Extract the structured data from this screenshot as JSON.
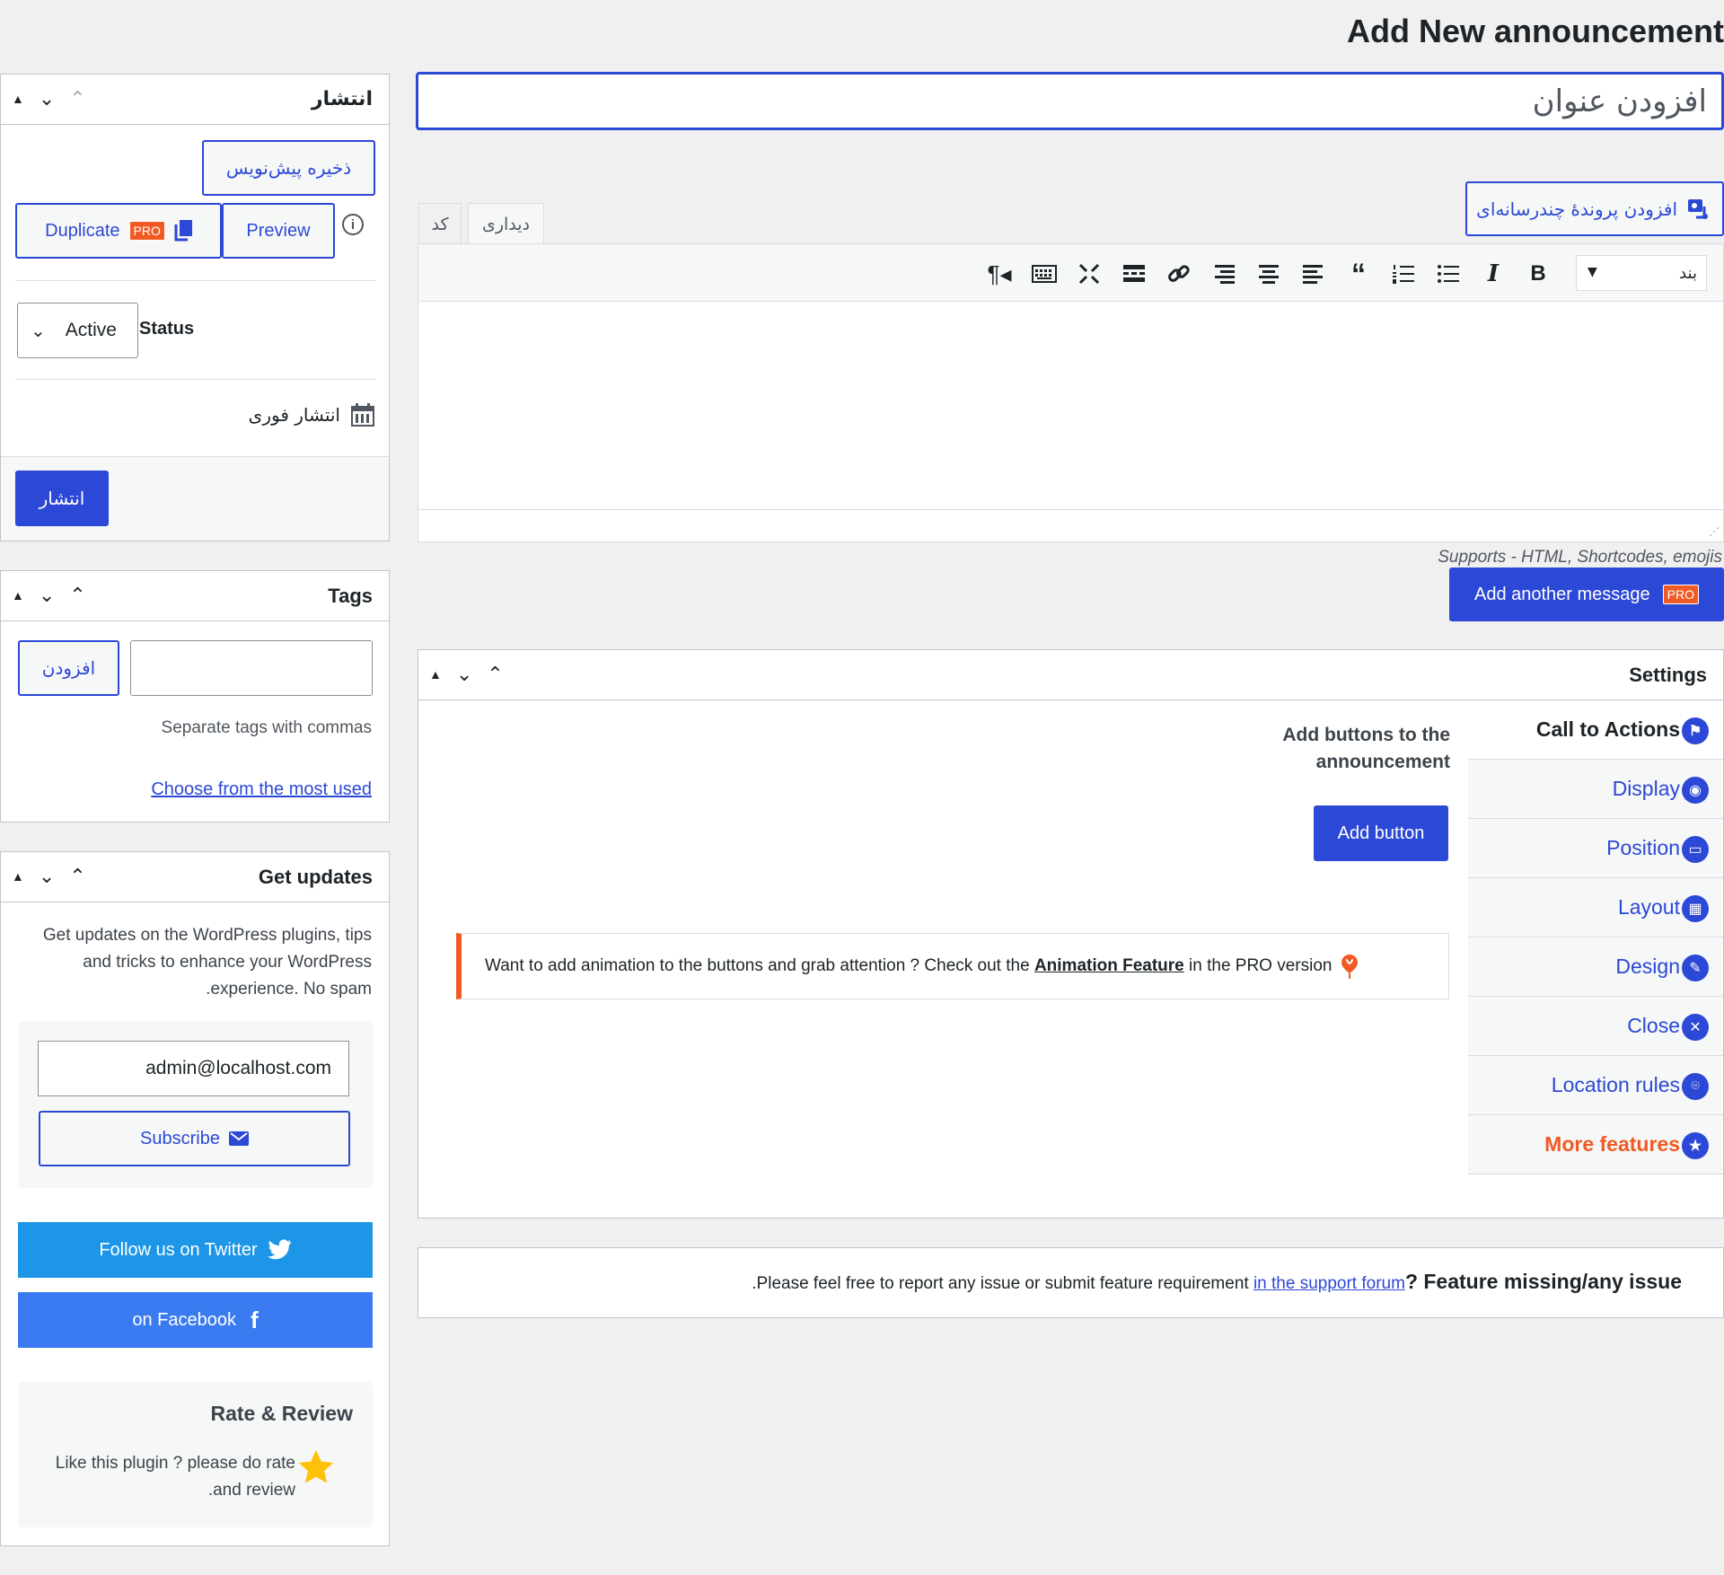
{
  "page": {
    "title": "Add New announcement"
  },
  "editor": {
    "title_placeholder": "افزودن عنوان",
    "add_media_label": "افزودن پروندهٔ چندرسانه‌ای",
    "tab_code": "کد",
    "tab_visual": "دیداری",
    "paragraph_select": "بند",
    "supports_note": "Supports - HTML, Shortcodes, emojis",
    "add_message_label": "Add another message",
    "pro_badge": "PRO",
    "toolbar_icons": [
      "paragraph-rtl-icon",
      "keyboard-icon",
      "fullscreen-icon",
      "read-more-icon",
      "link-icon",
      "align-right-icon",
      "align-center-icon",
      "align-left-icon",
      "blockquote-icon",
      "numbered-list-icon",
      "bullet-list-icon",
      "italic-icon",
      "bold-icon"
    ]
  },
  "publish": {
    "title": "انتشار",
    "save_draft": "ذخیره پیش‌نویس",
    "duplicate": "Duplicate",
    "pro_badge": "PRO",
    "preview": "Preview",
    "status_label": "Status",
    "status_value": "Active",
    "schedule_text": "انتشار فوری",
    "publish_button": "انتشار"
  },
  "tags": {
    "title": "Tags",
    "add_button": "افزودن",
    "hint": "Separate tags with commas",
    "choose_link": "Choose from the most used"
  },
  "updates": {
    "title": "Get updates",
    "description_lines": [
      "Get updates on the WordPress plugins, tips",
      "and tricks to enhance your WordPress",
      ".experience. No spam"
    ],
    "email_value": "admin@localhost.com",
    "subscribe": "Subscribe",
    "twitter": "Follow us on Twitter",
    "facebook": "on Facebook",
    "rate_title": "Rate & Review",
    "rate_lines": [
      "Like this plugin ? please do rate",
      ".and review"
    ]
  },
  "settings": {
    "title": "Settings",
    "section_heading_lines": [
      "Add buttons to the",
      "announcement"
    ],
    "add_button": "Add button",
    "notice_before": "Want to add animation to the buttons and grab attention ? Check out the ",
    "notice_link": "Animation Feature",
    "notice_after": " in the PRO version",
    "nav": [
      {
        "label": "Call to Actions",
        "icon": "flag-icon"
      },
      {
        "label": "Display",
        "icon": "eye-icon"
      },
      {
        "label": "Position",
        "icon": "window-icon"
      },
      {
        "label": "Layout",
        "icon": "layout-icon"
      },
      {
        "label": "Design",
        "icon": "brush-icon"
      },
      {
        "label": "Close",
        "icon": "close-icon"
      },
      {
        "label": "Location rules",
        "icon": "location-icon"
      },
      {
        "label": "More features",
        "icon": "star-icon"
      }
    ]
  },
  "feedback": {
    "bold": "? Feature missing/any issue",
    "text": ".Please feel free to report any issue or submit feature requirement ",
    "link": "in the support forum"
  },
  "colors": {
    "accent": "#2c48d6",
    "orange": "#f15a24",
    "twitter": "#1d96e8",
    "facebook": "#3b7bf2"
  }
}
